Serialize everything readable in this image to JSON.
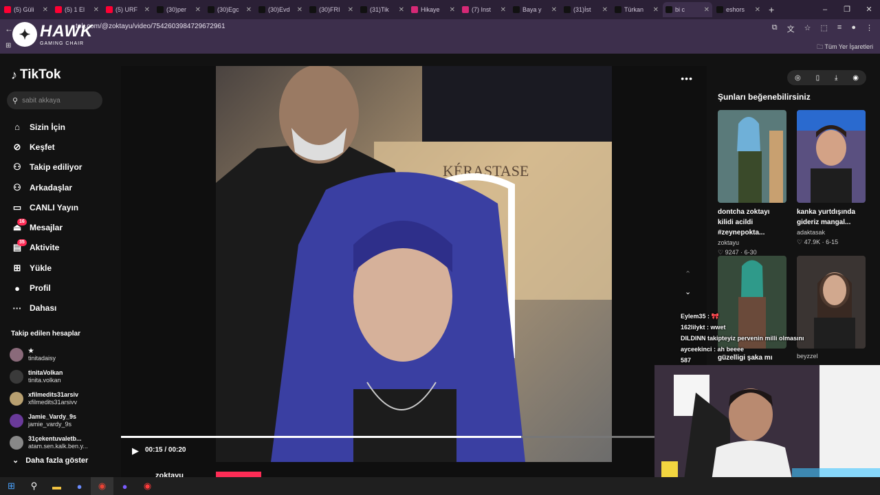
{
  "browser": {
    "tabs": [
      {
        "title": "(5) Güli",
        "color": "#ff0033"
      },
      {
        "title": "(5) 1 El",
        "color": "#ff0033"
      },
      {
        "title": "(5) URF",
        "color": "#ff0033"
      },
      {
        "title": "(30)per",
        "color": "#111111"
      },
      {
        "title": "(30)Egc",
        "color": "#111111"
      },
      {
        "title": "(30)Evd",
        "color": "#111111"
      },
      {
        "title": "(30)FRI",
        "color": "#111111"
      },
      {
        "title": "(31)Tik",
        "color": "#111111"
      },
      {
        "title": "Hikaye",
        "color": "#d62976"
      },
      {
        "title": "(7) Inst",
        "color": "#d62976"
      },
      {
        "title": "Baya y",
        "color": "#111111"
      },
      {
        "title": "(31)İst",
        "color": "#111111"
      },
      {
        "title": "Türkan",
        "color": "#111111"
      },
      {
        "title": "bi c",
        "color": "#111111"
      },
      {
        "title": "eshors",
        "color": "#111111"
      }
    ],
    "active_tab_index": 13,
    "new_tab": "+",
    "url": "tok.com/@zoktayu/video/7542603984729672961",
    "bookmarks_all": "Tüm Yer İşaretleri"
  },
  "overlay": {
    "brand": "HAWK",
    "brand_sub": "GAMING CHAIR"
  },
  "tiktok": {
    "logo": "TikTok",
    "search_placeholder": "sabit akkaya",
    "nav": [
      {
        "label": "Sizin İçin",
        "icon": "home-icon"
      },
      {
        "label": "Keşfet",
        "icon": "compass-icon"
      },
      {
        "label": "Takip ediliyor",
        "icon": "following-icon"
      },
      {
        "label": "Arkadaşlar",
        "icon": "friends-icon"
      },
      {
        "label": "CANLI Yayın",
        "icon": "live-icon"
      },
      {
        "label": "Mesajlar",
        "icon": "messages-icon",
        "badge": "16"
      },
      {
        "label": "Aktivite",
        "icon": "activity-icon",
        "badge": "35"
      },
      {
        "label": "Yükle",
        "icon": "upload-icon"
      },
      {
        "label": "Profil",
        "icon": "profile-icon"
      },
      {
        "label": "Dahası",
        "icon": "more-icon"
      }
    ],
    "following_header": "Takip edilen hesaplar",
    "following": [
      {
        "name": "★",
        "user": "tinitadaisy",
        "color": "#8a6a7a"
      },
      {
        "name": "tinitaVolkan",
        "user": "tinita.volkan",
        "color": "#3a3a3a"
      },
      {
        "name": "xfilmedits31arsiv",
        "user": "xfilmedits31arsivv",
        "color": "#b8a070"
      },
      {
        "name": "Jamie_Vardy_9s",
        "user": "jamie_vardy_9s",
        "color": "#6a3a9a"
      },
      {
        "name": "31çekentuvaletb...",
        "user": "atam.sen.kalk.ben.y...",
        "color": "#888888"
      }
    ],
    "show_more": "Daha fazla göster"
  },
  "player": {
    "time": "00:15 / 00:20",
    "progress": 0.75,
    "author": "zoktayu"
  },
  "suggestions": {
    "title": "Şunları beğenebilirsiniz",
    "cards": [
      {
        "title": "dontcha zoktayı kilidi acildi #zeynepokta...",
        "user": "zoktayu",
        "meta": "♡ 9247 · 6-30"
      },
      {
        "title": "kanka yurtdışında gideriz mangal...",
        "user": "adaktasak",
        "meta": "♡ 47.9K · 6-15"
      },
      {
        "title": "güzelligi şaka mı",
        "user": "",
        "meta": ""
      },
      {
        "title": "",
        "user": "beyzzel",
        "meta": ""
      }
    ]
  },
  "chat": [
    {
      "text": "Eylem35 : 🎀"
    },
    {
      "text": "162lilykt : wwet"
    },
    {
      "text": "DILDINN takipteyiz pervenin milli olmasını"
    },
    {
      "text": "ayceekinci : ah beeee"
    },
    {
      "text": "587"
    }
  ]
}
